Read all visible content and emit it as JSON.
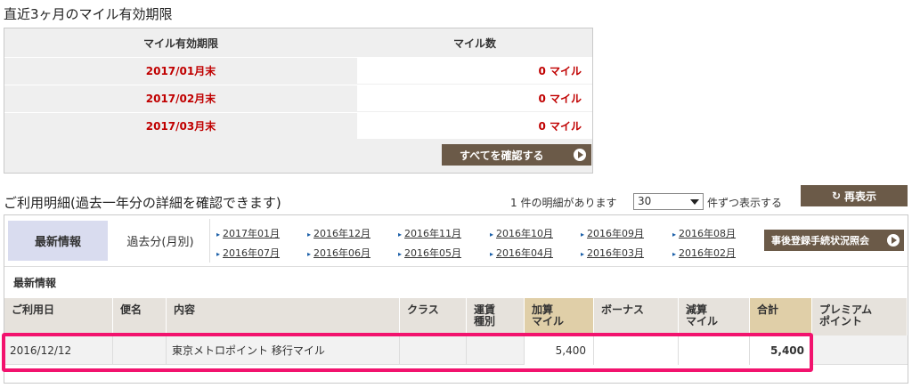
{
  "expiration": {
    "title": "直近3ヶ月のマイル有効期限",
    "col_date": "マイル有効期限",
    "col_miles": "マイル数",
    "rows": [
      {
        "date": "2017/01月末",
        "miles": "0 マイル"
      },
      {
        "date": "2017/02月末",
        "miles": "0 マイル"
      },
      {
        "date": "2017/03月末",
        "miles": "0 マイル"
      }
    ],
    "confirm_all": "すべてを確認する"
  },
  "usage": {
    "title": "ご利用明細(過去一年分の詳細を確認できます)",
    "count_text": "1 件の明細があります",
    "per_page_value": "30",
    "per_page_suffix": "件ずつ表示する",
    "refresh": "再表示",
    "tab_latest": "最新情報",
    "tab_past": "過去分(月別)",
    "months": [
      "2017年01月",
      "2016年12月",
      "2016年11月",
      "2016年10月",
      "2016年09月",
      "2016年08月",
      "2016年07月",
      "2016年06月",
      "2016年05月",
      "2016年04月",
      "2016年03月",
      "2016年02月"
    ],
    "after_registration": "事後登録手続状況照会",
    "section_label": "最新情報",
    "columns": {
      "date": "ご利用日",
      "flight": "便名",
      "content": "内容",
      "class": "クラス",
      "fare1": "運賃",
      "fare2": "種別",
      "add1": "加算",
      "add2": "マイル",
      "bonus": "ボーナス",
      "sub1": "減算",
      "sub2": "マイル",
      "total": "合計",
      "premium1": "プレミアム",
      "premium2": "ポイント"
    },
    "rows": [
      {
        "date": "2016/12/12",
        "flight": "",
        "content": "東京メトロポイント 移行マイル",
        "class": "",
        "fare": "",
        "add": "5,400",
        "bonus": "",
        "sub": "",
        "total": "5,400",
        "premium": ""
      }
    ]
  },
  "colors": {
    "button": "#6b5a48",
    "expiry_red": "#c00000",
    "highlight": "#f2136e"
  }
}
